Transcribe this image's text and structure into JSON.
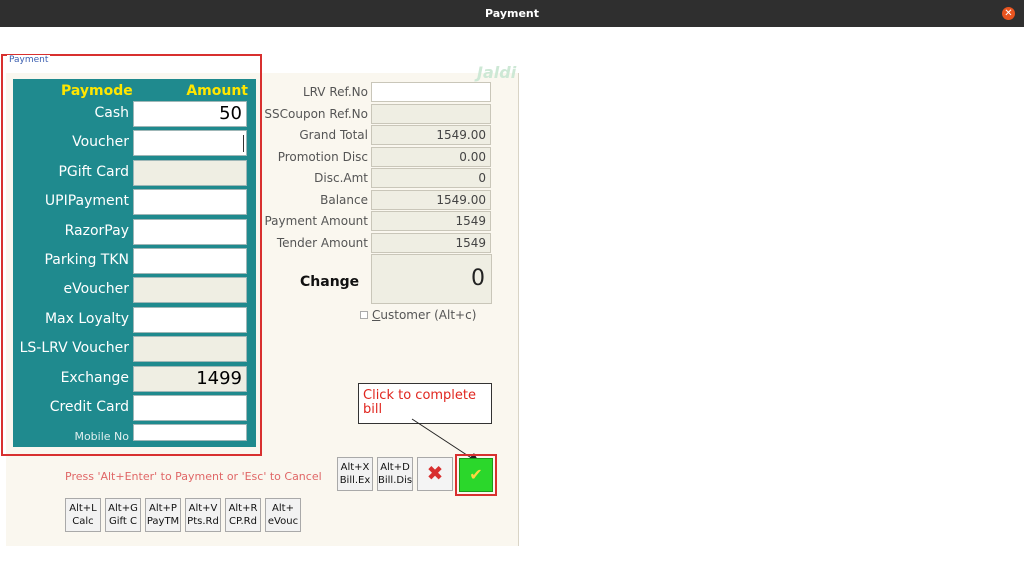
{
  "window": {
    "title": "Payment",
    "close_glyph": "✕"
  },
  "payment_group": {
    "legend": "Payment"
  },
  "paymode": {
    "header_mode": "Paymode",
    "header_amount": "Amount",
    "rows": [
      {
        "label": "Cash",
        "value": "50",
        "disabled": false
      },
      {
        "label": "Voucher",
        "value": "",
        "disabled": false
      },
      {
        "label": "PGift Card",
        "value": "",
        "disabled": true
      },
      {
        "label": "UPIPayment",
        "value": "",
        "disabled": false
      },
      {
        "label": "RazorPay",
        "value": "",
        "disabled": false
      },
      {
        "label": "Parking TKN",
        "value": "",
        "disabled": false
      },
      {
        "label": "eVoucher",
        "value": "",
        "disabled": true
      },
      {
        "label": "Max Loyalty",
        "value": "",
        "disabled": false
      },
      {
        "label": "LS-LRV Voucher",
        "value": "",
        "disabled": true
      },
      {
        "label": "Exchange",
        "value": "1499",
        "disabled": true
      },
      {
        "label": "Credit Card",
        "value": "",
        "disabled": false
      },
      {
        "label": "Mobile No",
        "value": "",
        "disabled": false
      }
    ]
  },
  "watermark": "Jaldi",
  "info": [
    {
      "label": "LRV Ref.No",
      "value": ""
    },
    {
      "label": "SSCoupon Ref.No",
      "value": ""
    },
    {
      "label": "Grand Total",
      "value": "1549.00"
    },
    {
      "label": "Promotion Disc",
      "value": "0.00"
    },
    {
      "label": "Disc.Amt",
      "value": "0"
    },
    {
      "label": "Balance",
      "value": "1549.00"
    },
    {
      "label": "Payment Amount",
      "value": "1549"
    },
    {
      "label": "Tender Amount",
      "value": "1549"
    }
  ],
  "change": {
    "label": "Change",
    "value": "0"
  },
  "customer": {
    "underline_char": "C",
    "rest": "ustomer (Alt+c)"
  },
  "callout": {
    "text": "Click to complete bill"
  },
  "hint": "Press 'Alt+Enter' to Payment or 'Esc' to Cancel",
  "shortcuts_top": [
    {
      "line1": "Alt+X",
      "line2": "Bill.Ex"
    },
    {
      "line1": "Alt+D",
      "line2": "Bill.Dis"
    }
  ],
  "shortcuts_bottom": [
    {
      "line1": "Alt+L",
      "line2": "Calc"
    },
    {
      "line1": "Alt+G",
      "line2": "Gift C"
    },
    {
      "line1": "Alt+P",
      "line2": "PayTM"
    },
    {
      "line1": "Alt+V",
      "line2": "Pts.Rd"
    },
    {
      "line1": "Alt+R",
      "line2": "CP.Rd"
    },
    {
      "line1": "Alt+",
      "line2": "eVouc"
    }
  ],
  "cancel_glyph": "✖",
  "ok_glyph": "✔",
  "colors": {
    "teal": "#1f8a8e",
    "yellow_header": "#ffe600",
    "ok_green": "#2bd72b",
    "highlight_red": "#d8302f"
  }
}
